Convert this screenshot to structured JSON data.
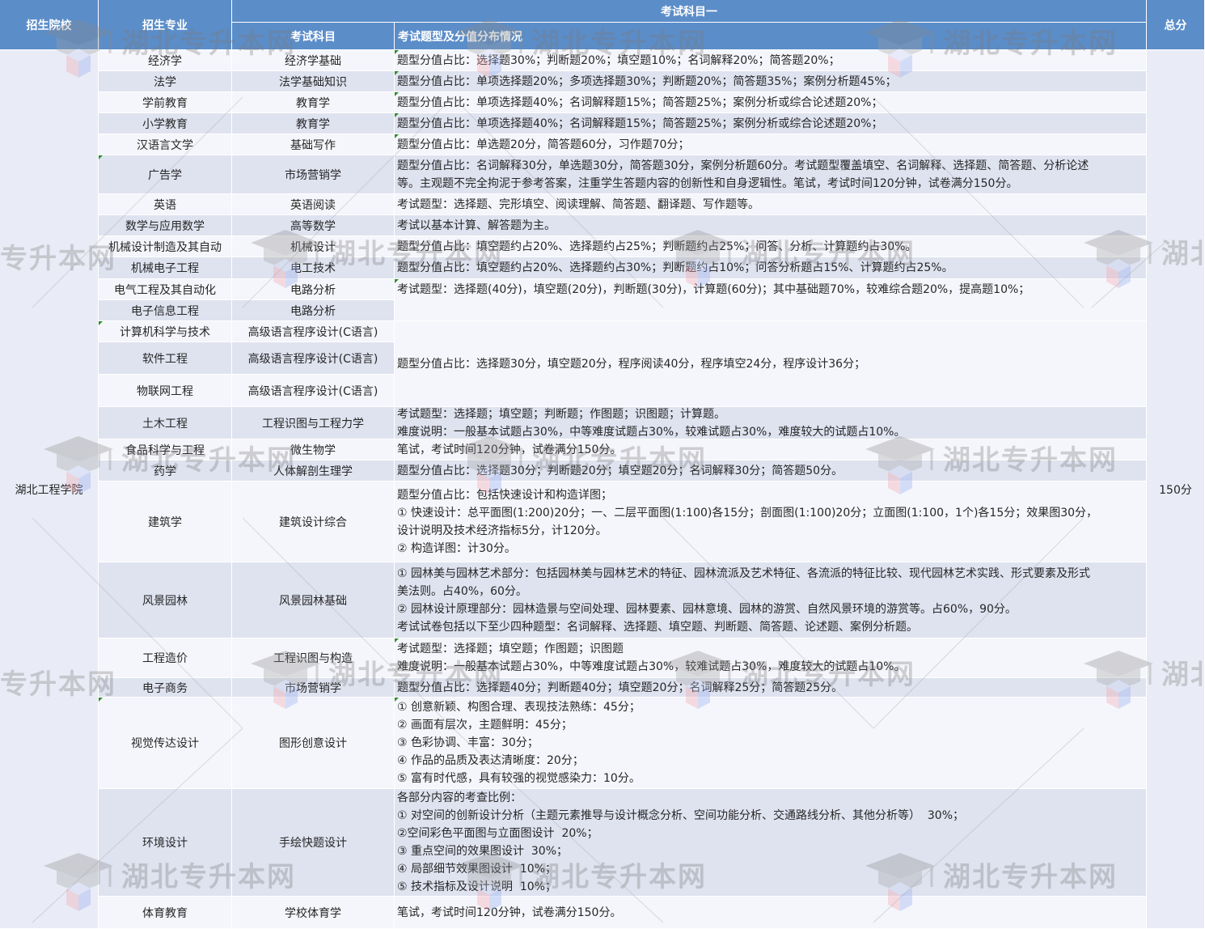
{
  "header": {
    "school": "招生院校",
    "major": "招生专业",
    "group": "考试科目一",
    "subject": "考试科目",
    "distribution": "考试题型及分值分布情况",
    "total": "总分"
  },
  "school_name": "湖北工程学院",
  "total_score": "150分",
  "watermark": "湖北专升本网",
  "watermark_partial_left": "专升本网",
  "watermark_partial_right": "湖北",
  "colors": {
    "header": "#5b8dc9",
    "row_light": "#f5f6fb",
    "row_dark": "#dfe3f0",
    "school_cell": "#e9ecf6"
  },
  "rows": [
    {
      "major": "经济学",
      "subject": "经济学基础",
      "desc": [
        "题型分值占比：选择题30%；判断题20%；填空题10%；名词解释20%；简答题20%；"
      ]
    },
    {
      "major": "法学",
      "subject": "法学基础知识",
      "desc": [
        "题型分值占比：单项选择题20%；多项选择题30%；判断题20%；简答题35%；案例分析题45%；"
      ]
    },
    {
      "major": "学前教育",
      "subject": "教育学",
      "desc": [
        "题型分值占比：单项选择题40%；名词解释题15%；简答题25%；案例分析或综合论述题20%；"
      ]
    },
    {
      "major": "小学教育",
      "subject": "教育学",
      "desc": [
        "题型分值占比：单项选择题40%；名词解释题15%；简答题25%；案例分析或综合论述题20%；"
      ]
    },
    {
      "major": "汉语言文学",
      "subject": "基础写作",
      "desc": [
        "题型分值占比：单选题20分，简答题60分，习作题70分；"
      ]
    },
    {
      "major": "广告学",
      "subject": "市场营销学",
      "desc": [
        "题型分值占比：名词解释30分，单选题30分，简答题30分，案例分析题60分。考试题型覆盖填空、名词解释、选择题、简答题、分析论述",
        "等。主观题不完全拘泥于参考答案，注重学生答题内容的创新性和自身逻辑性。笔试，考试时间120分钟，试卷满分150分。"
      ]
    },
    {
      "major": "英语",
      "subject": "英语阅读",
      "desc": [
        "考试题型：选择题、完形填空、阅读理解、简答题、翻译题、写作题等。"
      ]
    },
    {
      "major": "数学与应用数学",
      "subject": "高等数学",
      "desc": [
        "考试以基本计算、解答题为主。"
      ]
    },
    {
      "major": "机械设计制造及其自动",
      "subject": "机械设计",
      "desc": [
        "题型分值占比：填空题约占20%、选择题约占25%；判断题约占25%；问答、分析、计算题约占30%。"
      ]
    },
    {
      "major": "机械电子工程",
      "subject": "电工技术",
      "desc": [
        "题型分值占比：填空题约占20%、选择题约占30%；判断题约占10%；问答分析题占15%、计算题约占25%。"
      ]
    },
    {
      "major": "电气工程及其自动化",
      "subject": "电路分析",
      "desc": [
        "考试题型：选择题(40分)，填空题(20分)，判断题(30分)，计算题(60分)；其中基础题70%，较难综合题20%，提高题10%；"
      ]
    },
    {
      "major": "电子信息工程",
      "subject": "电路分析",
      "desc": []
    },
    {
      "major": "计算机科学与技术",
      "subject": "高级语言程序设计(C语言)",
      "desc": [
        "题型分值占比：选择题30分，填空题20分，程序阅读40分，程序填空24分，程序设计36分；"
      ]
    },
    {
      "major": "软件工程",
      "subject": "高级语言程序设计(C语言)",
      "desc": []
    },
    {
      "major": "物联网工程",
      "subject": "高级语言程序设计(C语言)",
      "desc": []
    },
    {
      "major": "土木工程",
      "subject": "工程识图与工程力学",
      "desc": [
        "考试题型：选择题；填空题；判断题；作图题；识图题；计算题。",
        "难度说明：一般基本试题占30%，中等难度试题占30%，较难试题占30%，难度较大的试题占10%。"
      ]
    },
    {
      "major": "食品科学与工程",
      "subject": "微生物学",
      "desc": [
        "笔试，考试时间120分钟，试卷满分150分。"
      ]
    },
    {
      "major": "药学",
      "subject": "人体解剖生理学",
      "desc": [
        "题型分值占比：选择题30分；判断题20分；填空题20分；名词解释30分；简答题50分。"
      ]
    },
    {
      "major": "建筑学",
      "subject": "建筑设计综合",
      "desc": [
        "题型分值占比：包括快速设计和构造详图；",
        "① 快速设计：总平面图(1:200)20分；一、二层平面图(1:100)各15分；剖面图(1:100)20分；立面图(1:100，1个)各15分；效果图30分，",
        "设计说明及技术经济指标5分，计120分。",
        "② 构造详图：计30分。"
      ]
    },
    {
      "major": "风景园林",
      "subject": "风景园林基础",
      "desc": [
        "① 园林美与园林艺术部分：包括园林美与园林艺术的特征、园林流派及艺术特征、各流派的特征比较、现代园林艺术实践、形式要素及形式",
        "美法则。占40%，60分。",
        "② 园林设计原理部分：园林造景与空间处理、园林要素、园林意境、园林的游赏、自然风景环境的游赏等。占60%，90分。",
        "考试试卷包括以下至少四种题型：名词解释、选择题、填空题、判断题、简答题、论述题、案例分析题。"
      ]
    },
    {
      "major": "工程造价",
      "subject": "工程识图与构造",
      "desc": [
        "考试题型：选择题；填空题；作图题；识图题",
        "难度说明：一般基本试题占30%，中等难度试题占30%，较难试题占30%，难度较大的试题占10%。"
      ]
    },
    {
      "major": "电子商务",
      "subject": "市场营销学",
      "desc": [
        "题型分值占比：选择题40分；判断题40分；填空题20分；名词解释25分；简答题25分。"
      ]
    },
    {
      "major": "视觉传达设计",
      "subject": "图形创意设计",
      "desc": [
        "① 创意新颖、构图合理、表现技法熟练：45分；",
        "② 画面有层次，主题鲜明：45分；",
        "③ 色彩协调、丰富：30分；",
        "④ 作品的品质及表达清晰度：20分；",
        "⑤ 富有时代感，具有较强的视觉感染力：10分。"
      ]
    },
    {
      "major": "环境设计",
      "subject": "手绘快题设计",
      "desc": [
        "各部分内容的考查比例：",
        "① 对空间的创新设计分析（主题元素推导与设计概念分析、空间功能分析、交通路线分析、其他分析等）  30%；",
        "②空间彩色平面图与立面图设计  20%；",
        "③ 重点空间的效果图设计  30%；",
        "④ 局部细节效果图设计  10%；",
        "⑤ 技术指标及设计说明  10%；"
      ]
    },
    {
      "major": "体育教育",
      "subject": "学校体育学",
      "desc": [
        "笔试，考试时间120分钟，试卷满分150分。"
      ]
    }
  ]
}
